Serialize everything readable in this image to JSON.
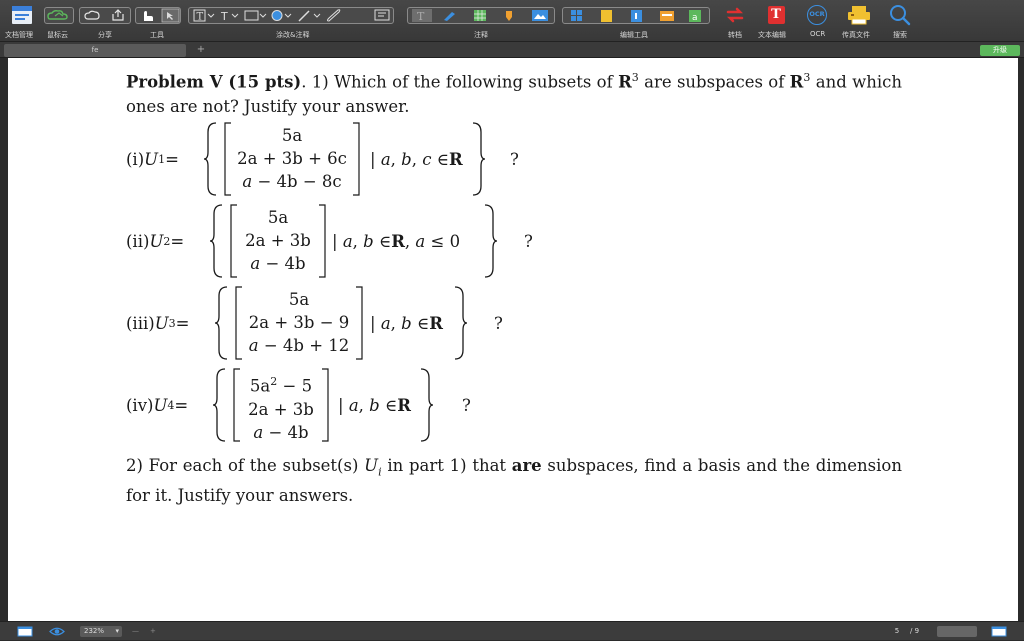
{
  "toolbar": {
    "groups": [
      {
        "label": "文档管理"
      },
      {
        "label": "鼠标云"
      },
      {
        "label": "分享"
      },
      {
        "label": "工具"
      },
      {
        "label": "涂改&注释"
      },
      {
        "label": "注释"
      },
      {
        "label": "编辑工具"
      },
      {
        "label": "转档"
      },
      {
        "label": "文本编辑"
      },
      {
        "label": "OCR"
      },
      {
        "label": "传真文件"
      },
      {
        "label": "搜索"
      }
    ],
    "ocr_badge": "OCR",
    "text_edit_glyph": "T"
  },
  "tabs": {
    "active": "fe",
    "add": "+",
    "upgrade": "升级"
  },
  "doc": {
    "p1_title": "Problem V (15 pts)",
    "p1_a": ". 1) Which of the following subsets of ",
    "R": "R",
    "exp3": "3",
    "p1_b": " are subspaces of ",
    "p1_c": " and which ones are not? Justify your answer.",
    "items": [
      {
        "label": "(i) ",
        "set": "U",
        "sub": "1",
        "eq": " =",
        "rows": [
          "5a",
          "2a + 3b + 6c",
          "a − 4b − 8c"
        ],
        "cond": "| a, b, c ∈ ",
        "cond_tail": "",
        "q": "?"
      },
      {
        "label": "(ii) ",
        "set": "U",
        "sub": "2",
        "eq": " =",
        "rows": [
          "5a",
          "2a + 3b",
          "a − 4b"
        ],
        "cond": "| a, b ∈ ",
        "cond_tail": ",   a ≤ 0",
        "q": "?"
      },
      {
        "label": "(iii) ",
        "set": "U",
        "sub": "3",
        "eq": " =",
        "rows": [
          "5a",
          "2a + 3b − 9",
          "a − 4b + 12"
        ],
        "cond": "| a, b ∈ ",
        "cond_tail": "",
        "q": "?"
      },
      {
        "label": "(iv) ",
        "set": "U",
        "sub": "4",
        "eq": " =",
        "rows": [
          "5a² − 5",
          "2a + 3b",
          "a − 4b"
        ],
        "cond": "| a, b ∈ ",
        "cond_tail": "",
        "q": "?"
      }
    ],
    "p2_a": "2) For each of the subset(s) ",
    "p2_u": "U",
    "p2_i": "i",
    "p2_b": " in part 1) that ",
    "p2_are": "are",
    "p2_c": " subspaces, find a basis and the dimension for it. Justify your answers."
  },
  "status": {
    "zoom": "232%",
    "minus": "—",
    "plus": "+",
    "page_current": "5",
    "page_total": "/ 9"
  },
  "colors": {
    "toolbar_bg": "#3f3f3f",
    "accent_red": "#e03030",
    "accent_green": "#5cb85c",
    "accent_blue": "#3b8fe0"
  }
}
